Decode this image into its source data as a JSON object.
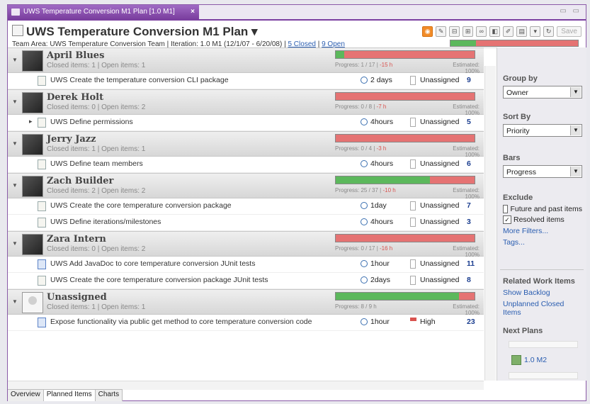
{
  "window": {
    "tab_title": "UWS Temperature Conversion M1 Plan [1.0 M1]",
    "tab_close": "×",
    "window_controls": "▭ ▭"
  },
  "header": {
    "title": "UWS Temperature Conversion M1 Plan ▾",
    "save_label": "Save",
    "info_prefix": "Team Area: UWS Temperature Conversion Team | Iteration: 1.0 M1 (12/1/07 - 6/20/08) | ",
    "closed_link": "5 Closed",
    "info_sep": " | ",
    "open_link": "9 Open",
    "overall_progress": 0.2
  },
  "groups": [
    {
      "name": "April Blues",
      "sub": "Closed items: 1 | Open items: 1",
      "progress_label": "Progress: 1 / 17 | ",
      "progress_neg": "-15 h",
      "estimated": "Estimated: 100%",
      "progress": 0.06,
      "items": [
        {
          "title": "UWS Create the temperature conversion CLI package",
          "est": "2 days",
          "prio": "Unassigned",
          "num": "9",
          "expand": "",
          "type": "task"
        }
      ]
    },
    {
      "name": "Derek Holt",
      "sub": "Closed items: 0 | Open items: 2",
      "progress_label": "Progress: 0 / 8 | ",
      "progress_neg": "-7 h",
      "estimated": "Estimated: 100%",
      "progress": 0.0,
      "items": [
        {
          "title": "UWS Define permissions",
          "est": "4hours",
          "prio": "Unassigned",
          "num": "5",
          "expand": "▸",
          "type": "task"
        }
      ]
    },
    {
      "name": "Jerry Jazz",
      "sub": "Closed items: 1 | Open items: 1",
      "progress_label": "Progress: 0 / 4 | ",
      "progress_neg": "-3 h",
      "estimated": "Estimated: 100%",
      "progress": 0.0,
      "items": [
        {
          "title": "UWS Define team members",
          "est": "4hours",
          "prio": "Unassigned",
          "num": "6",
          "expand": "",
          "type": "task"
        }
      ]
    },
    {
      "name": "Zach Builder",
      "sub": "Closed items: 2 | Open items: 2",
      "progress_label": "Progress: 25 / 37 | ",
      "progress_neg": "-10 h",
      "estimated": "Estimated: 100%",
      "progress": 0.68,
      "items": [
        {
          "title": "UWS Create the core temperature conversion package",
          "est": "1day",
          "prio": "Unassigned",
          "num": "7",
          "expand": "",
          "type": "task"
        },
        {
          "title": "UWS Define iterations/milestones",
          "est": "4hours",
          "prio": "Unassigned",
          "num": "3",
          "expand": "",
          "type": "task"
        }
      ]
    },
    {
      "name": "Zara Intern",
      "sub": "Closed items: 0 | Open items: 2",
      "progress_label": "Progress: 0 / 17 | ",
      "progress_neg": "-16 h",
      "estimated": "Estimated: 100%",
      "progress": 0.0,
      "items": [
        {
          "title": "UWS Add JavaDoc to core temperature conversion JUnit tests",
          "est": "1hour",
          "prio": "Unassigned",
          "num": "11",
          "expand": "",
          "type": "story"
        },
        {
          "title": "UWS Create the core temperature conversion package JUnit tests",
          "est": "2days",
          "prio": "Unassigned",
          "num": "8",
          "expand": "",
          "type": "task"
        }
      ]
    },
    {
      "name": "Unassigned",
      "sub": "Closed items: 1 | Open items: 1",
      "progress_label": "Progress: 8 / 9 h",
      "progress_neg": "",
      "estimated": "Estimated: 100%",
      "progress": 0.89,
      "avatar": "unassigned",
      "items": [
        {
          "title": "Expose functionality via public get method to core temperature conversion code",
          "est": "1hour",
          "prio": "High",
          "num": "23",
          "expand": "",
          "type": "story",
          "high": true
        }
      ]
    }
  ],
  "sidebar": {
    "group_by_label": "Group by",
    "group_by_value": "Owner",
    "sort_by_label": "Sort By",
    "sort_by_value": "Priority",
    "bars_label": "Bars",
    "bars_value": "Progress",
    "exclude_label": "Exclude",
    "exclude_future": "Future and past items",
    "exclude_future_checked": false,
    "exclude_resolved": "Resolved items",
    "exclude_resolved_checked": true,
    "more_filters": "More Filters...",
    "tags": "Tags...",
    "related_label": "Related Work Items",
    "show_backlog": "Show Backlog",
    "unplanned_closed": "Unplanned Closed Items",
    "next_plans_label": "Next Plans",
    "next_plan": "1.0 M2"
  },
  "bottom_tabs": [
    "Overview",
    "Planned Items",
    "Charts"
  ]
}
